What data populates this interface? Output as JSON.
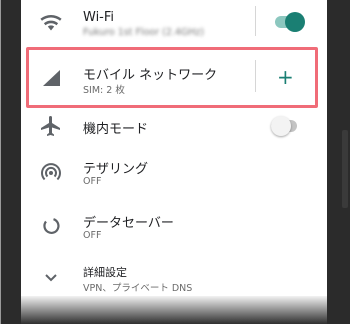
{
  "settings": {
    "wifi": {
      "title": "Wi-Fi",
      "subtitle": "Fukuro 1st Floor (2.4GHz)",
      "enabled": true
    },
    "mobile": {
      "title": "モバイル ネットワーク",
      "subtitle": "SIM: 2 枚",
      "add_label": "+"
    },
    "airplane": {
      "title": "機内モード",
      "enabled": false
    },
    "tethering": {
      "title": "テザリング",
      "subtitle": "OFF"
    },
    "datasaver": {
      "title": "データセーバー",
      "subtitle": "OFF"
    },
    "advanced": {
      "title": "詳細設定",
      "subtitle": "VPN、プライベート DNS"
    }
  },
  "colors": {
    "accent": "#1a7f73",
    "highlight": "#f06c78",
    "icon": "#5f6368"
  },
  "icons": [
    "wifi-icon",
    "signal-icon",
    "airplane-icon",
    "hotspot-icon",
    "data-saver-icon",
    "chevron-down-icon"
  ]
}
